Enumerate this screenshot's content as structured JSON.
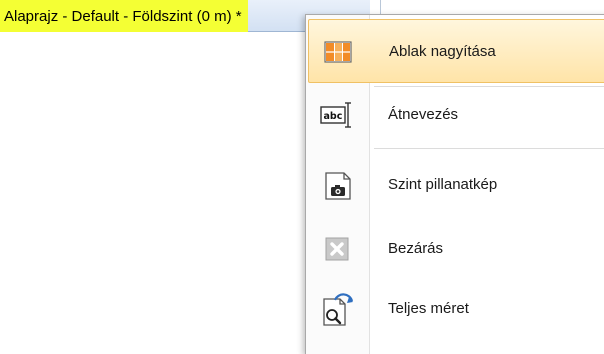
{
  "tabs": {
    "active_title": "Alaprajz - Default - Földszint (0 m) *"
  },
  "context_menu": {
    "items": [
      {
        "label": "Ablak nagyítása",
        "icon": "maximize-window-icon",
        "highlighted": true
      },
      {
        "label": "Átnevezés",
        "icon": "rename-abc-icon",
        "highlighted": false
      },
      {
        "label": "Szint pillanatkép",
        "icon": "snapshot-camera-icon",
        "highlighted": false
      },
      {
        "label": "Bezárás",
        "icon": "close-x-icon",
        "highlighted": false
      },
      {
        "label": "Teljes méret",
        "icon": "full-size-zoom-icon",
        "highlighted": false
      }
    ]
  },
  "colors": {
    "highlight_fill": "#ffe4a8",
    "highlight_border": "#f0c164",
    "tab_label_highlight": "#f4ff34",
    "icon_orange": "#f28c28"
  }
}
